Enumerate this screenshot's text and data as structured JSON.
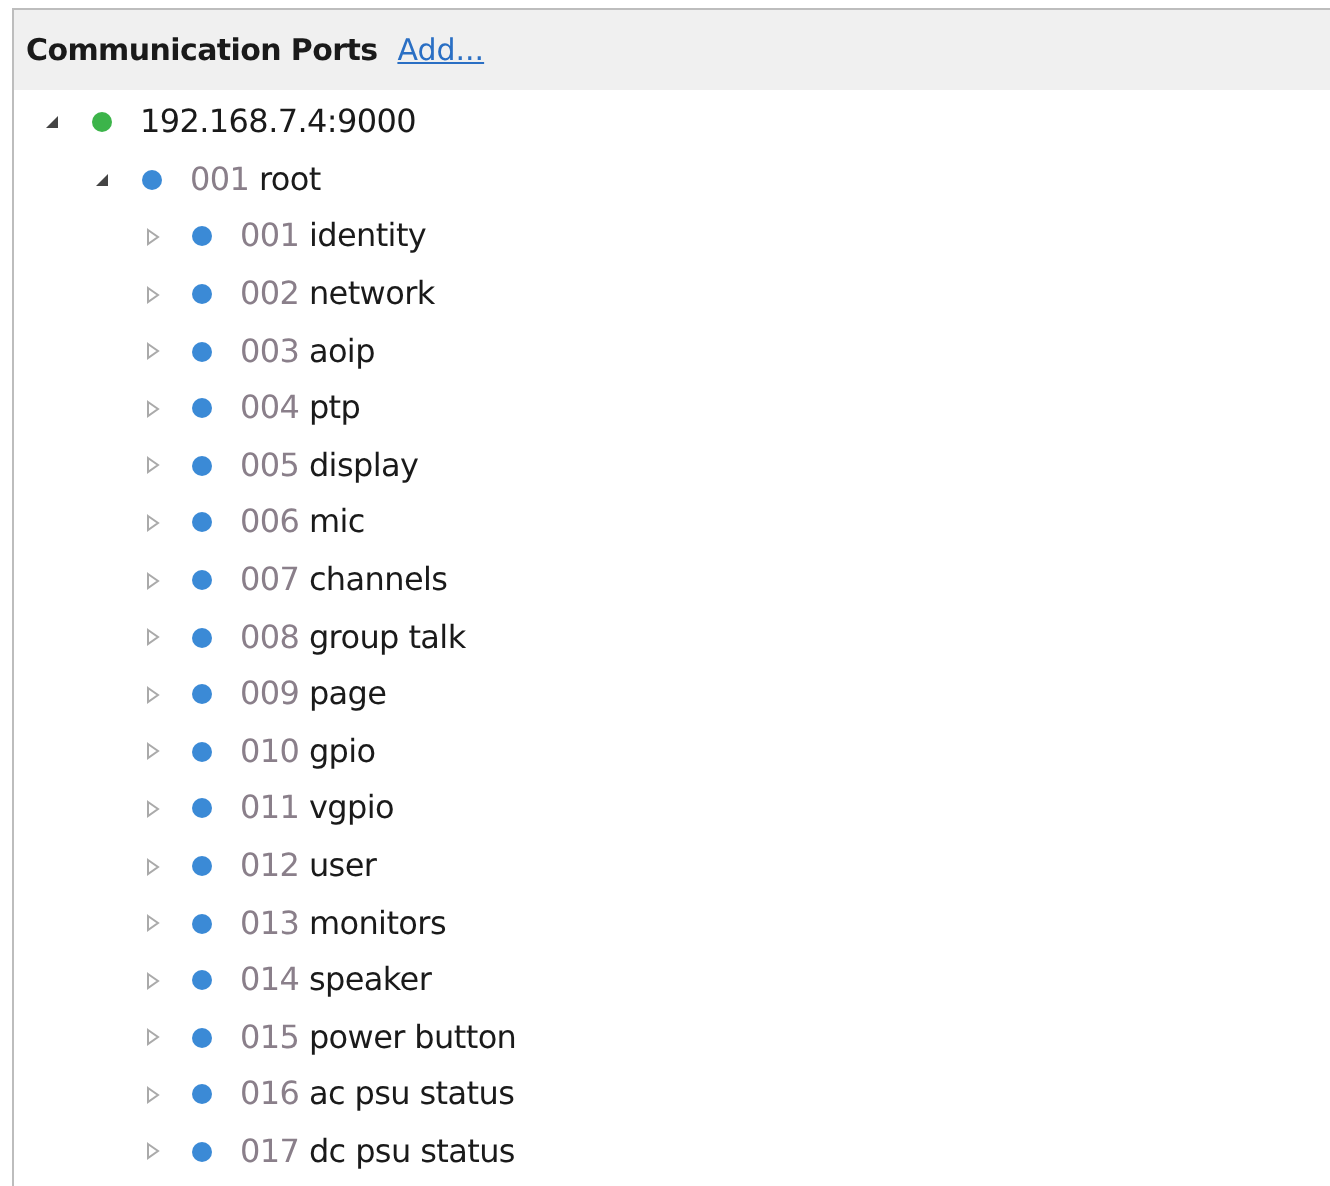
{
  "header": {
    "title": "Communication Ports",
    "add_link": "Add..."
  },
  "tree": [
    {
      "label": "192.168.7.4:9000",
      "color": "#3cb44a",
      "expanded": true,
      "children": [
        {
          "number": "001",
          "label": "root",
          "color": "#3b8ad6",
          "expanded": true,
          "children": [
            {
              "number": "001",
              "label": "identity",
              "color": "#3b8ad6",
              "expanded": false
            },
            {
              "number": "002",
              "label": "network",
              "color": "#3b8ad6",
              "expanded": false
            },
            {
              "number": "003",
              "label": "aoip",
              "color": "#3b8ad6",
              "expanded": false
            },
            {
              "number": "004",
              "label": "ptp",
              "color": "#3b8ad6",
              "expanded": false
            },
            {
              "number": "005",
              "label": "display",
              "color": "#3b8ad6",
              "expanded": false
            },
            {
              "number": "006",
              "label": "mic",
              "color": "#3b8ad6",
              "expanded": false
            },
            {
              "number": "007",
              "label": "channels",
              "color": "#3b8ad6",
              "expanded": false
            },
            {
              "number": "008",
              "label": "group talk",
              "color": "#3b8ad6",
              "expanded": false
            },
            {
              "number": "009",
              "label": "page",
              "color": "#3b8ad6",
              "expanded": false
            },
            {
              "number": "010",
              "label": "gpio",
              "color": "#3b8ad6",
              "expanded": false
            },
            {
              "number": "011",
              "label": "vgpio",
              "color": "#3b8ad6",
              "expanded": false
            },
            {
              "number": "012",
              "label": "user",
              "color": "#3b8ad6",
              "expanded": false
            },
            {
              "number": "013",
              "label": "monitors",
              "color": "#3b8ad6",
              "expanded": false
            },
            {
              "number": "014",
              "label": "speaker",
              "color": "#3b8ad6",
              "expanded": false
            },
            {
              "number": "015",
              "label": "power button",
              "color": "#3b8ad6",
              "expanded": false
            },
            {
              "number": "016",
              "label": "ac psu status",
              "color": "#3b8ad6",
              "expanded": false
            },
            {
              "number": "017",
              "label": "dc psu status",
              "color": "#3b8ad6",
              "expanded": false
            }
          ]
        }
      ]
    }
  ]
}
